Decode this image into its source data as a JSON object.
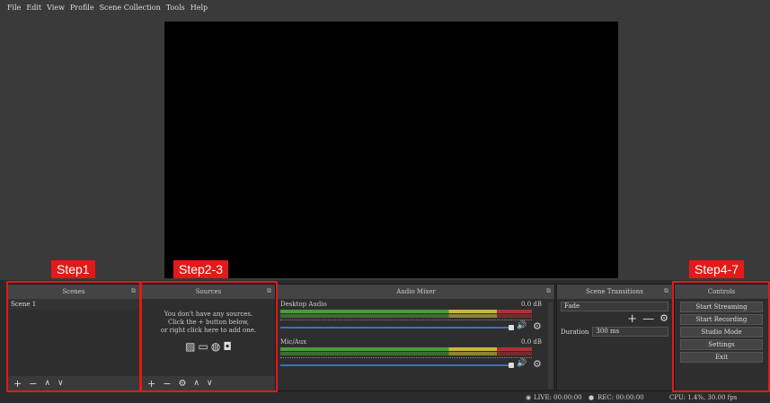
{
  "menu": [
    "File",
    "Edit",
    "View",
    "Profile",
    "Scene Collection",
    "Tools",
    "Help"
  ],
  "steps": {
    "step1": "Step1",
    "step2": "Step2-3",
    "step3": "Step4-7"
  },
  "scenes": {
    "title": "Scenes",
    "items": [
      "Scene 1"
    ],
    "footer": {
      "add": "+",
      "remove": "−",
      "up": "∧",
      "down": "∨"
    }
  },
  "sources": {
    "title": "Sources",
    "empty_line1": "You don't have any sources.",
    "empty_line2": "Click the + button below,",
    "empty_line3": "or right click here to add one.",
    "footer": {
      "add": "+",
      "remove": "−",
      "settings": "⚙",
      "up": "∧",
      "down": "∨"
    }
  },
  "mixer": {
    "title": "Audio Mixer",
    "channels": [
      {
        "name": "Desktop Audio",
        "db": "0.0 dB"
      },
      {
        "name": "Mic/Aux",
        "db": "0.0 dB"
      }
    ]
  },
  "transitions": {
    "title": "Scene Transitions",
    "selected": "Fade",
    "duration_label": "Duration",
    "duration_value": "300 ms"
  },
  "controls": {
    "title": "Controls",
    "buttons": [
      "Start Streaming",
      "Start Recording",
      "Studio Mode",
      "Settings",
      "Exit"
    ]
  },
  "status": {
    "live": "LIVE: 00:00:00",
    "rec": "REC: 00:00:00",
    "cpu": "CPU: 1.4%, 30.00 fps"
  },
  "colors": {
    "accent": "#e21a1a",
    "slider": "#3d6fbf"
  }
}
